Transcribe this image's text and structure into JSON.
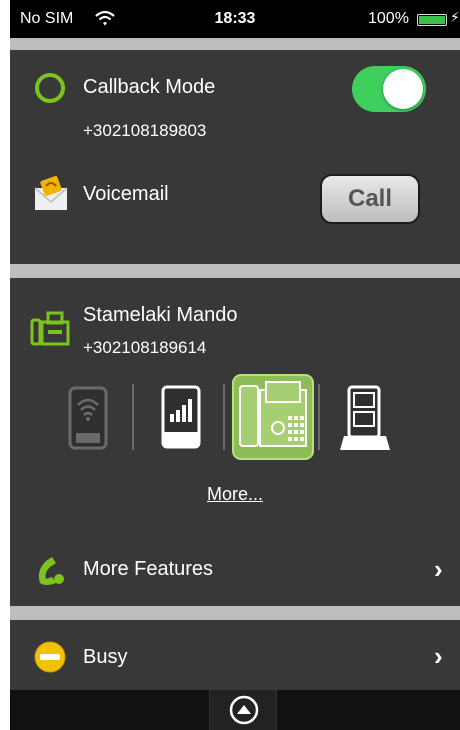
{
  "status_bar": {
    "carrier": "No SIM",
    "time": "18:33",
    "battery": "100%"
  },
  "callback": {
    "label": "Callback Mode",
    "number": "+302108189803",
    "toggle_on": true
  },
  "voicemail": {
    "label": "Voicemail",
    "call_label": "Call"
  },
  "device": {
    "name": "Stamelaki Mando",
    "number": "+302108189614",
    "selected_index": 2,
    "more_link": "More..."
  },
  "features": {
    "label": "More Features"
  },
  "presence": {
    "label": "Busy"
  },
  "colors": {
    "accent_green": "#7bc41e",
    "toggle_green": "#3fcf5d",
    "busy_yellow": "#f2c200"
  }
}
